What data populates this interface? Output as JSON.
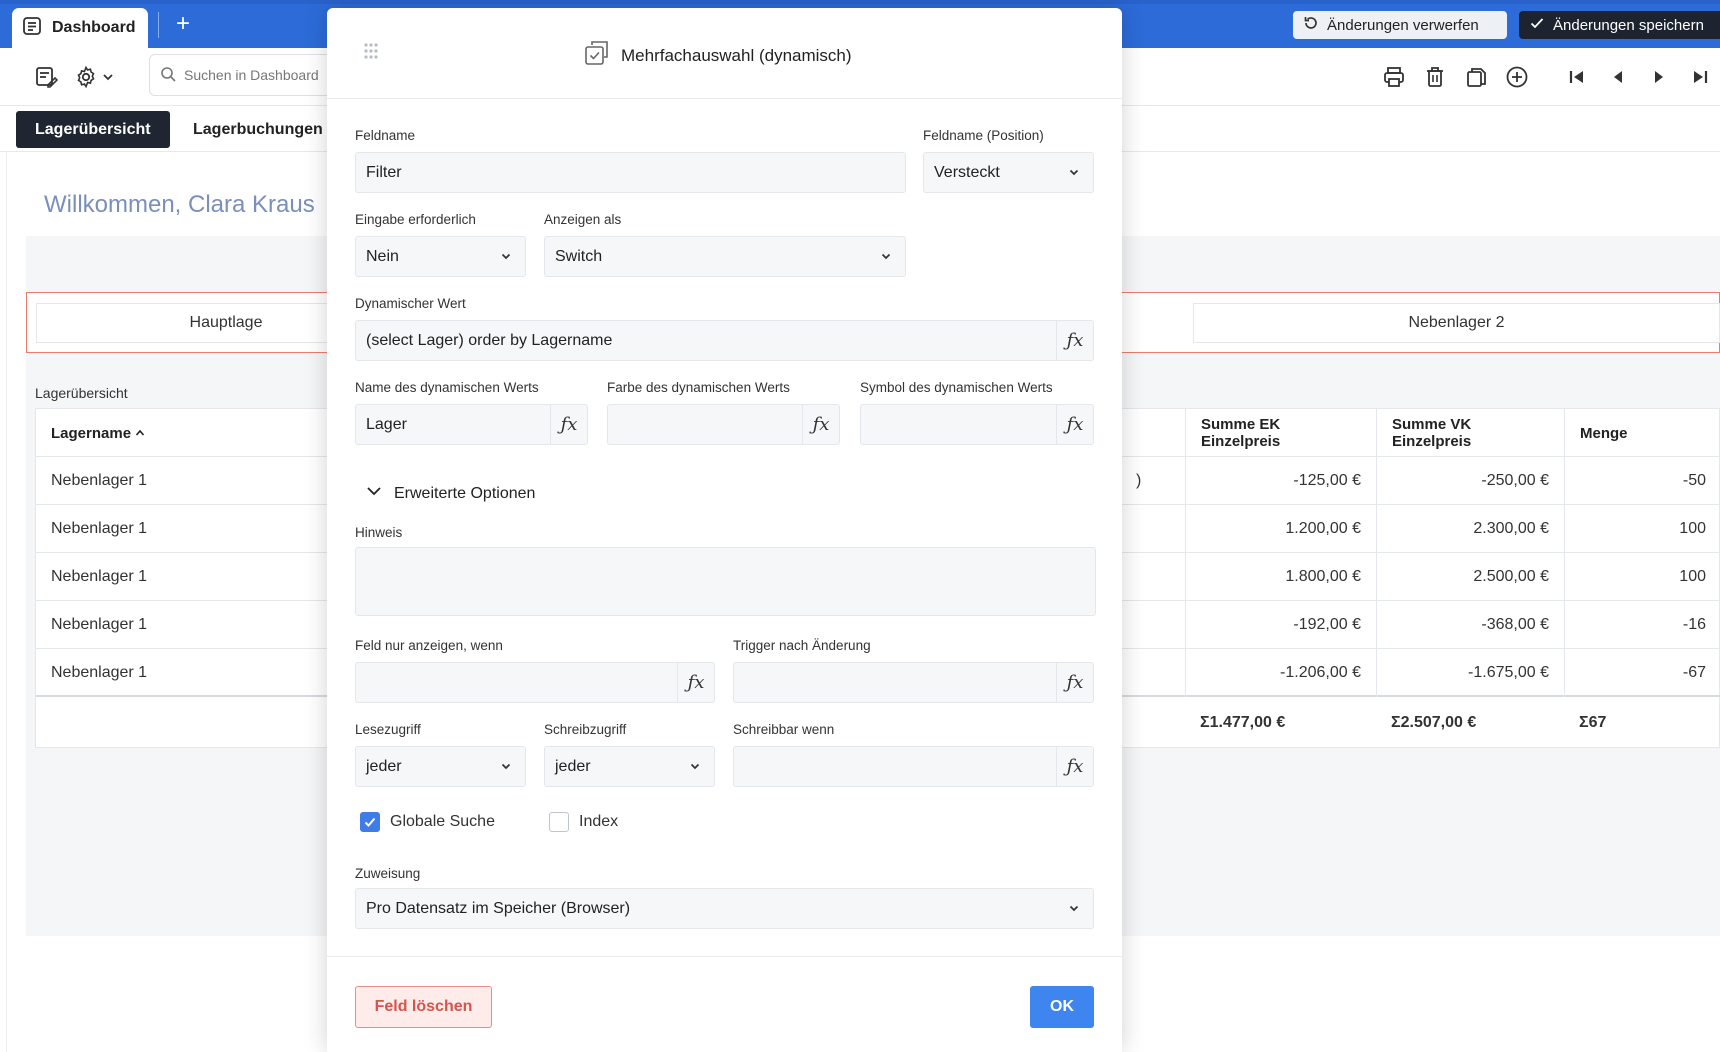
{
  "app": {
    "tab_title": "Dashboard",
    "discard_label": "Änderungen verwerfen",
    "save_label": "Änderungen speichern"
  },
  "toolbar": {
    "search_placeholder": "Suchen in Dashboard"
  },
  "page_tabs": [
    {
      "label": "Lagerübersicht",
      "active": true
    },
    {
      "label": "Lagerbuchungen",
      "active": false
    }
  ],
  "welcome": "Willkommen, Clara Kraus",
  "filter_items": [
    "Hauptlage",
    "Nebenlager 2"
  ],
  "grid": {
    "title": "Lagerübersicht",
    "columns": {
      "lagername": "Lagername",
      "ek": "Summe EK Einzelpreis",
      "vk": "Summe VK Einzelpreis",
      "menge": "Menge"
    },
    "rows": [
      {
        "lagername": "Nebenlager 1",
        "partial": ")",
        "ek": "-125,00 €",
        "vk": "-250,00 €",
        "menge": "-50"
      },
      {
        "lagername": "Nebenlager 1",
        "partial": "",
        "ek": "1.200,00 €",
        "vk": "2.300,00 €",
        "menge": "100"
      },
      {
        "lagername": "Nebenlager 1",
        "partial": "",
        "ek": "1.800,00 €",
        "vk": "2.500,00 €",
        "menge": "100"
      },
      {
        "lagername": "Nebenlager 1",
        "partial": "",
        "ek": "-192,00 €",
        "vk": "-368,00 €",
        "menge": "-16"
      },
      {
        "lagername": "Nebenlager 1",
        "partial": "",
        "ek": "-1.206,00 €",
        "vk": "-1.675,00 €",
        "menge": "-67"
      }
    ],
    "sums": {
      "ek": "Σ1.477,00 €",
      "vk": "Σ2.507,00 €",
      "menge": "Σ67"
    }
  },
  "modal": {
    "title": "Mehrfachauswahl (dynamisch)",
    "fields": {
      "feldname": {
        "label": "Feldname",
        "value": "Filter"
      },
      "feldname_position": {
        "label": "Feldname (Position)",
        "value": "Versteckt"
      },
      "eingabe": {
        "label": "Eingabe erforderlich",
        "value": "Nein"
      },
      "anzeigen": {
        "label": "Anzeigen als",
        "value": "Switch"
      },
      "dyn_wert": {
        "label": "Dynamischer Wert",
        "value": "(select Lager) order by Lagername"
      },
      "dyn_name": {
        "label": "Name des dynamischen Werts",
        "value": "Lager"
      },
      "dyn_farbe": {
        "label": "Farbe des dynamischen Werts",
        "value": ""
      },
      "dyn_symbol": {
        "label": "Symbol des dynamischen Werts",
        "value": ""
      },
      "hinweis": {
        "label": "Hinweis",
        "value": ""
      },
      "nur_anzeigen": {
        "label": "Feld nur anzeigen, wenn",
        "value": ""
      },
      "trigger": {
        "label": "Trigger nach Änderung",
        "value": ""
      },
      "lesezugriff": {
        "label": "Lesezugriff",
        "value": "jeder"
      },
      "schreibzugriff": {
        "label": "Schreibzugriff",
        "value": "jeder"
      },
      "schreibbar": {
        "label": "Schreibbar wenn",
        "value": ""
      },
      "zuweisung": {
        "label": "Zuweisung",
        "value": "Pro Datensatz im Speicher (Browser)"
      }
    },
    "advanced_label": "Erweiterte Optionen",
    "checkboxes": {
      "globale_suche": {
        "label": "Globale Suche",
        "checked": true
      },
      "index": {
        "label": "Index",
        "checked": false
      }
    },
    "fx_symbol": "ƒx",
    "delete_label": "Feld löschen",
    "ok_label": "OK"
  },
  "colors": {
    "accent": "#2c6bd8",
    "primary_button": "#3e85ef",
    "danger": "#d9534a"
  }
}
